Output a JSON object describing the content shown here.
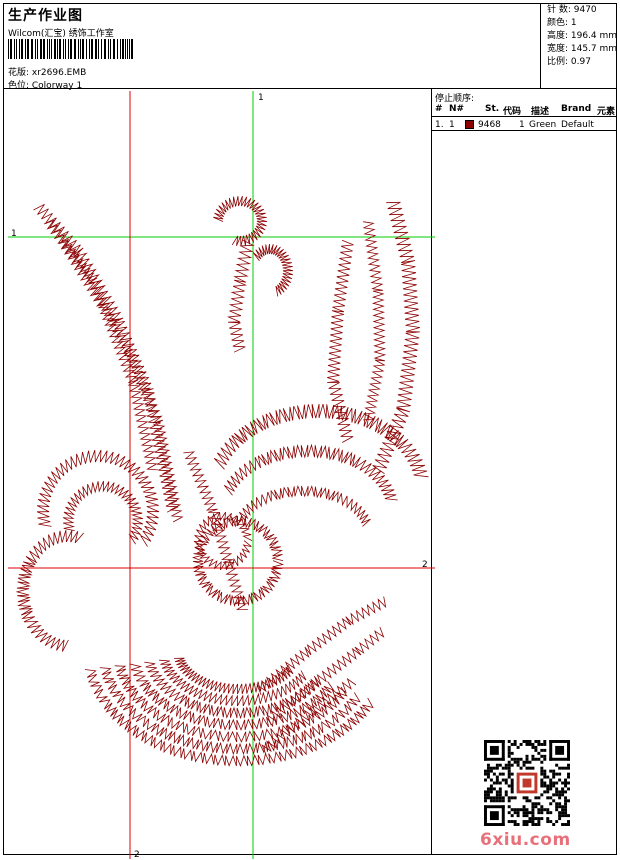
{
  "header": {
    "title": "生产作业图",
    "company": "Wilcom(汇宝) 绣饰工作室",
    "design_label": "花版: xr2696.EMB",
    "colorway_label": "色位:  Colorway 1"
  },
  "stats": {
    "stitches": "针 数: 9470",
    "colors": "颜色: 1",
    "height": "高度: 196.4 mm",
    "width": "宽度: 145.7 mm",
    "scale": "比例: 0.97"
  },
  "stop_sequence": {
    "title": "停止顺序:",
    "columns": {
      "num": "#",
      "n": "N#",
      "st": "St.",
      "code": "代码",
      "desc": "描述",
      "brand": "Brand",
      "element": "元素"
    },
    "rows": [
      {
        "num": "1.",
        "n": "1",
        "swatch_color": "#8B0000",
        "st": "9468",
        "code": "1",
        "desc": "Green",
        "brand": "Default"
      }
    ]
  },
  "axes": {
    "v_top_label": "1",
    "h_left_label": "1",
    "h_right_label": "2",
    "v_bottom_label": "2"
  },
  "colors": {
    "thread": "#8B0000",
    "green_guide": "#00cc00",
    "red_guide": "#dd0000"
  },
  "watermark": "6xiu.com"
}
